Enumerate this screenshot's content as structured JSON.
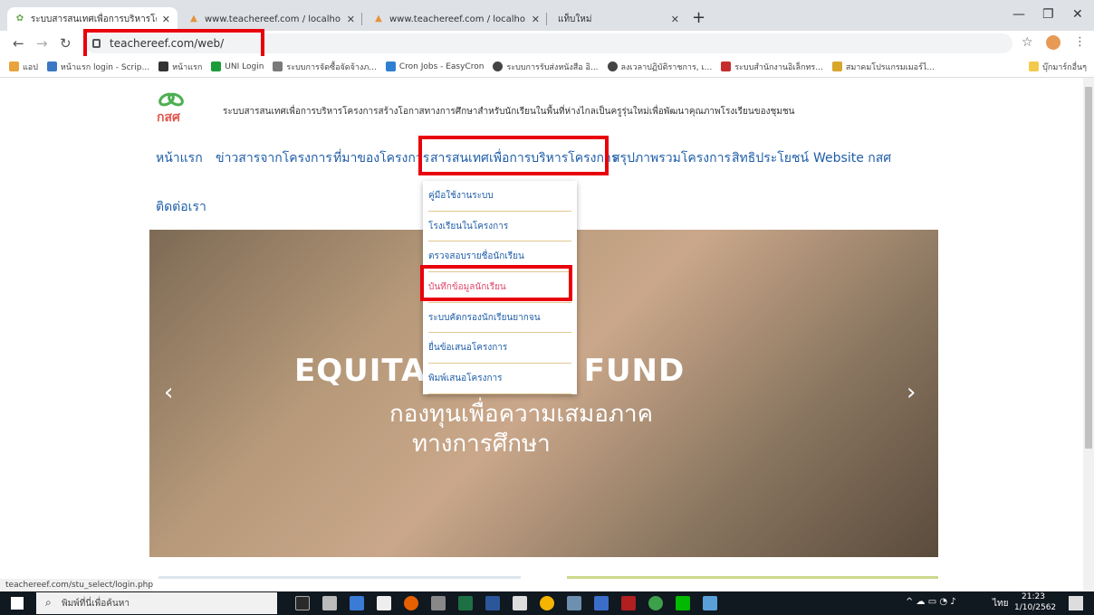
{
  "tabs": [
    {
      "title": "ระบบสารสนเทศเพื่อการบริหารโครงการ",
      "active": true
    },
    {
      "title": "www.teachereef.com / localhost",
      "active": false
    },
    {
      "title": "www.teachereef.com / localhost",
      "active": false
    },
    {
      "title": "แท็บใหม่",
      "active": false
    }
  ],
  "newtab_glyph": "+",
  "address": {
    "url": "teachereef.com/web/"
  },
  "bookmarks": [
    {
      "label": "แอป",
      "color": "#e8a33d"
    },
    {
      "label": "หน้าแรก login - Scrip...",
      "color": "#3b78c3"
    },
    {
      "label": "หน้าแรก",
      "color": "#333333"
    },
    {
      "label": "UNI Login",
      "color": "#1c9b3a"
    },
    {
      "label": "ระบบการจัดซื้อจัดจ้างภ...",
      "color": "#7a7a7a"
    },
    {
      "label": "Cron Jobs - EasyCron",
      "color": "#2f7fd1"
    },
    {
      "label": "ระบบการรับส่งหนังสือ อิ...",
      "color": "#444444"
    },
    {
      "label": "ลงเวลาปฏิบัติราชการ, เ...",
      "color": "#444444"
    },
    {
      "label": "ระบบสำนักงานอิเล็กทร...",
      "color": "#c62d2d"
    },
    {
      "label": "สมาคมโปรแกรมเมอร์ไ...",
      "color": "#d9a62c"
    }
  ],
  "bookmarks_other": "บุ๊กมาร์กอื่นๆ",
  "site": {
    "logo_text": "กสศ",
    "title": "ระบบสารสนเทศเพื่อการบริหารโครงการสร้างโอกาสทางการศึกษาสำหรับนักเรียนในพื้นที่ห่างไกลเป็นครูรุ่นใหม่เพื่อพัฒนาคุณภาพโรงเรียนของชุมชน",
    "nav": [
      "หน้าแรก",
      "ข่าวสารจากโครงการ",
      "ที่มาของโครงการ",
      "สารสนเทศเพื่อการบริหารโครงการ",
      "สรุปภาพรวมโครงการ",
      "สิทธิประโยชน์",
      "Website กสศ"
    ],
    "nav_row2": "ติดต่อเรา",
    "dropdown": [
      "คู่มือใช้งานระบบ",
      "โรงเรียนในโครงการ",
      "ตรวจสอบรายชื่อนักเรียน",
      "บันทึกข้อมูลนักเรียน",
      "ระบบคัดกรองนักเรียนยากจน",
      "ยื่นข้อเสนอโครงการ",
      "พิมพ์เสนอโครงการ"
    ],
    "hero_line1": "EQUITAB    ATION FUND",
    "hero_line2": "กองทุนเพื่อความเสมอภาค",
    "hero_line3": "ทางการศึกษา",
    "arrow_prev": "‹",
    "arrow_next": "›"
  },
  "status_url": "teachereef.com/stu_select/login.php",
  "taskbar": {
    "search_placeholder": "พิมพ์ที่นี่เพื่อค้นหา",
    "lang": "ไทย",
    "time": "21:23",
    "date": "1/10/2562"
  }
}
